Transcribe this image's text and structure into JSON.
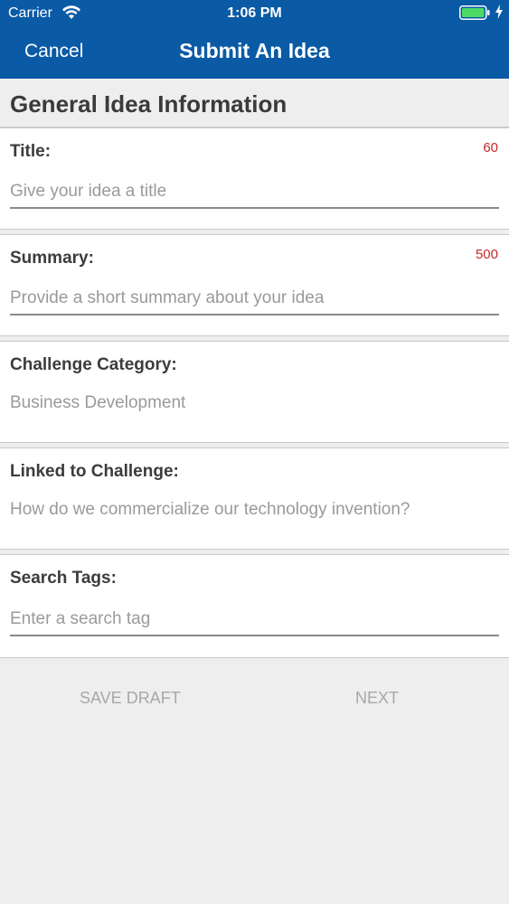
{
  "status_bar": {
    "carrier": "Carrier",
    "time": "1:06 PM",
    "battery_color": "#4cd964"
  },
  "nav": {
    "cancel_label": "Cancel",
    "title": "Submit An Idea"
  },
  "section": {
    "heading": "General Idea Information"
  },
  "form": {
    "title": {
      "label": "Title:",
      "counter": "60",
      "placeholder": "Give your idea a title"
    },
    "summary": {
      "label": "Summary:",
      "counter": "500",
      "placeholder": "Provide a short summary about your idea"
    },
    "challenge_category": {
      "label": "Challenge Category:",
      "value": "Business Development"
    },
    "linked_challenge": {
      "label": "Linked to Challenge:",
      "value": "How do we commercialize our technology invention?"
    },
    "search_tags": {
      "label": "Search Tags:",
      "placeholder": "Enter a search tag"
    }
  },
  "actions": {
    "save_draft_label": "SAVE DRAFT",
    "next_label": "NEXT"
  },
  "colors": {
    "header_bg": "#0a5aa5",
    "counter": "#c62828",
    "page_bg": "#eeeeee"
  }
}
